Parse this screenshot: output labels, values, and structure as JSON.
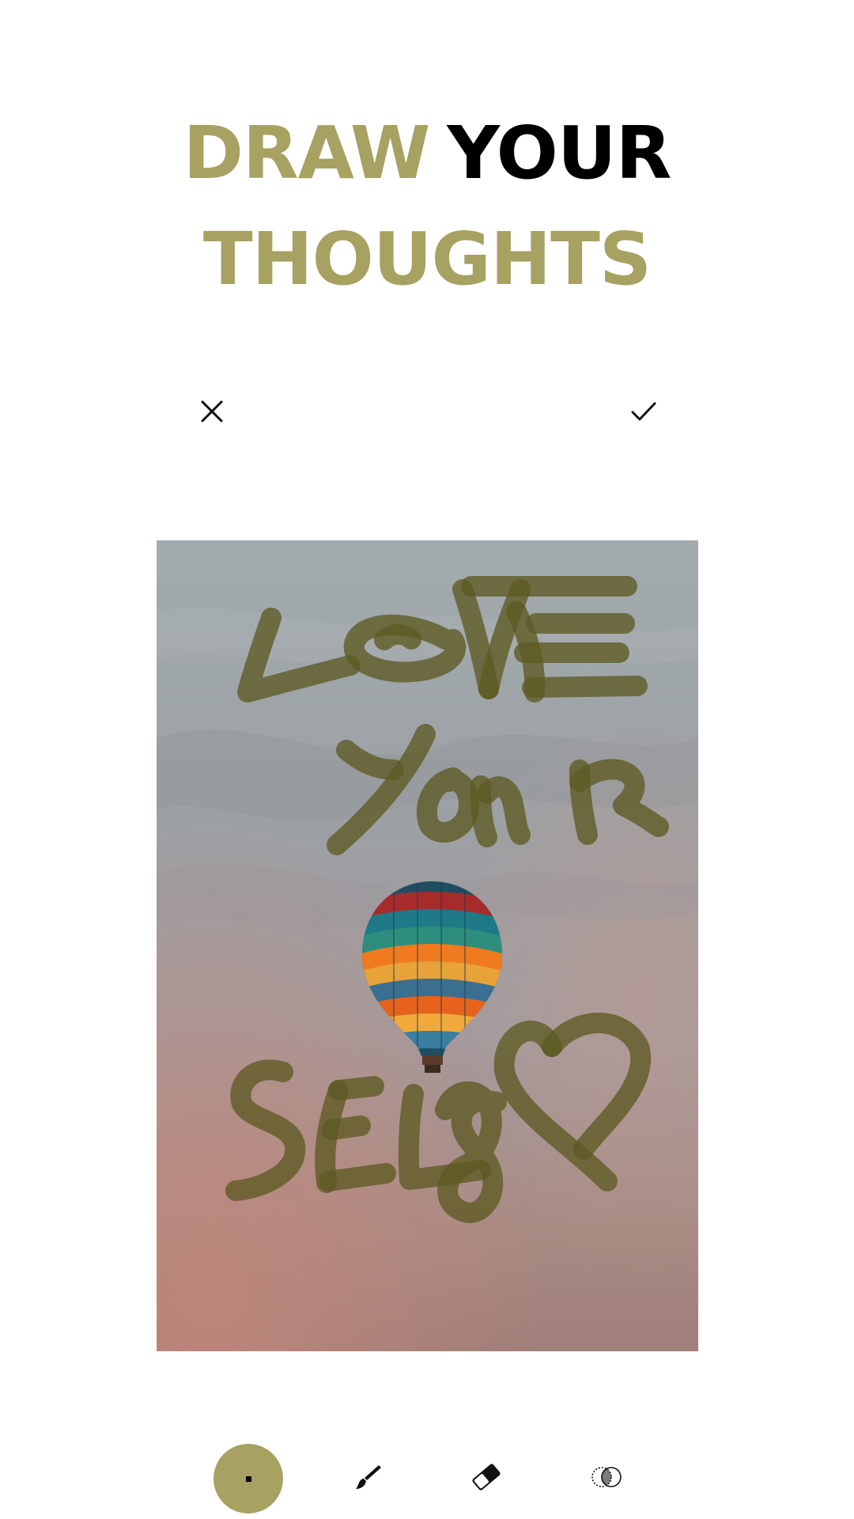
{
  "headline": {
    "line1": {
      "word1": "DRAW",
      "word2": "YOUR"
    },
    "line2": {
      "word1": "THOUGHTS"
    }
  },
  "colors": {
    "accent": "#A7A162",
    "text_dark": "#000000",
    "background": "#FFFFFF",
    "ink": "#5E5A22"
  },
  "top_toolbar": {
    "close_icon": "close-icon",
    "confirm_icon": "check-icon"
  },
  "canvas": {
    "image": "hot-air-balloon-sky-photo",
    "drawing": "LOVE YOUR SELF with heart"
  },
  "tools": [
    {
      "name": "color",
      "icon": "color-swatch"
    },
    {
      "name": "brush",
      "icon": "brush-icon"
    },
    {
      "name": "eraser",
      "icon": "eraser-icon"
    },
    {
      "name": "blend",
      "icon": "blend-icon"
    }
  ]
}
